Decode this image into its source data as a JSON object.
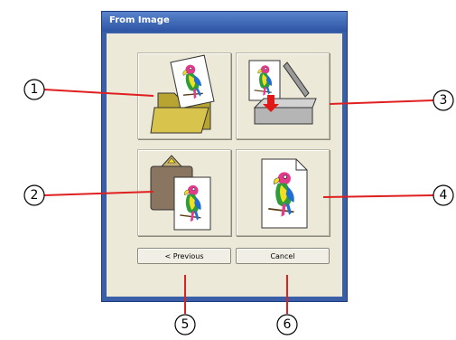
{
  "dialog": {
    "title": "From Image",
    "buttons": {
      "previous_label": "< Previous",
      "cancel_label": "Cancel"
    }
  },
  "options": [
    {
      "icon": "open-folder-image-icon"
    },
    {
      "icon": "scanner-import-icon"
    },
    {
      "icon": "clipboard-paste-image-icon"
    },
    {
      "icon": "image-file-icon"
    }
  ],
  "callouts": [
    "1",
    "2",
    "3",
    "4",
    "5",
    "6"
  ]
}
